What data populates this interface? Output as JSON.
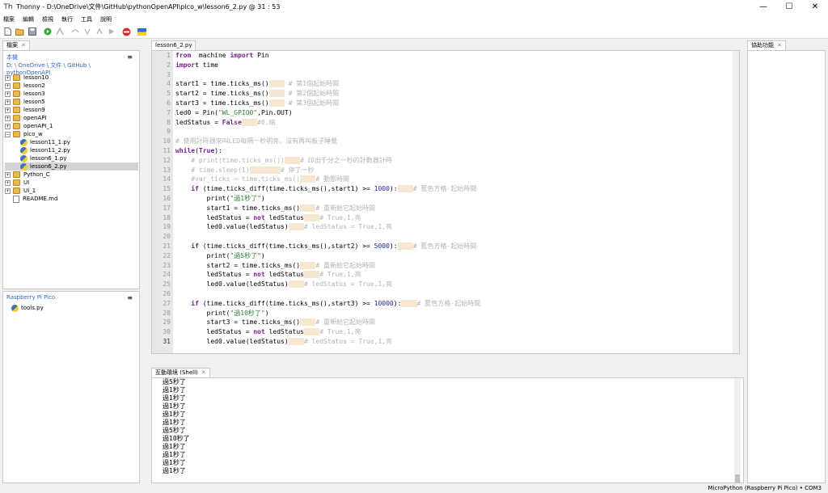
{
  "window": {
    "title": "Thonny  -  D:\\OneDrive\\文件\\GitHub\\pythonOpenAPI\\pico_w\\lesson6_2.py  @  31 : 53",
    "minimize": "—",
    "maximize": "☐",
    "close": "✕"
  },
  "menu": [
    "檔案",
    "編輯",
    "檢視",
    "執行",
    "工具",
    "說明"
  ],
  "files_panel": {
    "tab_label": "檔案",
    "local_label": "本機",
    "breadcrumb": "D: \\ OneDrive \\ 文件 \\ GitHub \\ pythonOpenAPI",
    "tree": [
      {
        "label": "lesson10",
        "type": "folder",
        "exp": "+"
      },
      {
        "label": "lesson2",
        "type": "folder",
        "exp": "+"
      },
      {
        "label": "lesson3",
        "type": "folder",
        "exp": "+"
      },
      {
        "label": "lesson5",
        "type": "folder",
        "exp": "+"
      },
      {
        "label": "lesson9",
        "type": "folder",
        "exp": "+"
      },
      {
        "label": "openAPI",
        "type": "folder",
        "exp": "+"
      },
      {
        "label": "openAPI_1",
        "type": "folder",
        "exp": "+"
      },
      {
        "label": "pico_w",
        "type": "folder",
        "exp": "−"
      },
      {
        "label": "lesson11_1.py",
        "type": "py"
      },
      {
        "label": "lesson11_2.py",
        "type": "py"
      },
      {
        "label": "lesson6_1.py",
        "type": "py"
      },
      {
        "label": "lesson6_2.py",
        "type": "py",
        "selected": true
      },
      {
        "label": "Python_C",
        "type": "folder",
        "exp": "+"
      },
      {
        "label": "UI",
        "type": "folder",
        "exp": "+"
      },
      {
        "label": "UI_1",
        "type": "folder",
        "exp": "+"
      },
      {
        "label": "README.md",
        "type": "doc"
      }
    ],
    "device_label": "Raspberry Pi Pico",
    "device_files": [
      "tools.py"
    ]
  },
  "editor": {
    "tab_label": "lesson6_2.py",
    "current_line": 31
  },
  "shell": {
    "tab_label": "互動環境 (Shell)",
    "lines": [
      "過5秒了",
      "過1秒了",
      "過1秒了",
      "過1秒了",
      "過1秒了",
      "過1秒了",
      "過5秒了",
      "過10秒了",
      "過1秒了",
      "過1秒了",
      "過1秒了",
      "過1秒了"
    ]
  },
  "assistant": {
    "tab_label": "協助功能"
  },
  "status": {
    "text": "MicroPython (Raspberry Pi Pico)  •  COM3"
  },
  "code_lines": [
    [
      [
        "kw",
        "from"
      ],
      [
        "",
        "  machine "
      ],
      [
        "kw",
        "import"
      ],
      [
        "",
        " Pin"
      ]
    ],
    [
      [
        "kw",
        "import"
      ],
      [
        "",
        " time"
      ]
    ],
    [],
    [
      [
        "",
        "start1 = time.ticks_ms()"
      ],
      [
        "sp",
        "    "
      ],
      [
        "cm",
        " # 第1個起始時間"
      ]
    ],
    [
      [
        "",
        "start2 = time.ticks_ms()"
      ],
      [
        "sp",
        "    "
      ],
      [
        "cm",
        " # 第2個起始時間"
      ]
    ],
    [
      [
        "",
        "start3 = time.ticks_ms()"
      ],
      [
        "sp",
        "    "
      ],
      [
        "cm",
        " # 第3個起始時間"
      ]
    ],
    [
      [
        "",
        "led0 = Pin("
      ],
      [
        "st",
        "\"WL_GPIO0\""
      ],
      [
        "",
        ",Pin.OUT)"
      ]
    ],
    [
      [
        "",
        "ledStatus = "
      ],
      [
        "kw",
        "False"
      ],
      [
        "sp",
        "    "
      ],
      [
        "cm",
        "#0,暗"
      ]
    ],
    [],
    [
      [
        "cm",
        "# 使用計時器來叫LED每隔一秒明亮，沒有再叫板子睡覺"
      ]
    ],
    [
      [
        "kw",
        "while"
      ],
      [
        "",
        "("
      ],
      [
        "kw",
        "True"
      ],
      [
        "",
        "):"
      ]
    ],
    [
      [
        "cm",
        "    # print(time.ticks_ms())"
      ],
      [
        "sp",
        "    "
      ],
      [
        "cm",
        "# 印出千分之一秒的計數器計時"
      ]
    ],
    [
      [
        "cm",
        "    # time.sleep(1)"
      ],
      [
        "sp",
        "        "
      ],
      [
        "cm",
        "# 停了一秒"
      ]
    ],
    [
      [
        "cm",
        "    #var_ticks = time.ticks_ms()"
      ],
      [
        "sp",
        "    "
      ],
      [
        "cm",
        "# 動態時間"
      ]
    ],
    [
      [
        "",
        "    "
      ],
      [
        "kw",
        "if"
      ],
      [
        "",
        " (time.ticks_diff(time.ticks_ms(),start1) >= "
      ],
      [
        "nm",
        "1000"
      ],
      [
        "",
        "):"
      ],
      [
        "sp",
        "    "
      ],
      [
        "cm",
        "# 藍色方格-起始時間"
      ]
    ],
    [
      [
        "",
        "        print("
      ],
      [
        "st",
        "\"過1秒了\""
      ],
      [
        "",
        ")"
      ]
    ],
    [
      [
        "",
        "        start1 = time.ticks_ms()"
      ],
      [
        "sp",
        "    "
      ],
      [
        "cm",
        "# 重新給它起始時間"
      ]
    ],
    [
      [
        "",
        "        ledStatus = "
      ],
      [
        "kw",
        "not"
      ],
      [
        "",
        " ledStatus"
      ],
      [
        "sp",
        "    "
      ],
      [
        "cm",
        "# True,1,亮"
      ]
    ],
    [
      [
        "",
        "        led0.value(ledStatus)"
      ],
      [
        "sp",
        "    "
      ],
      [
        "cm",
        "# ledStatus = True,1,亮"
      ]
    ],
    [],
    [
      [
        "",
        "    "
      ],
      [
        "kw",
        "if"
      ],
      [
        "",
        " (time.ticks_diff(time.ticks_ms(),start2) >= "
      ],
      [
        "nm",
        "5000"
      ],
      [
        "",
        "):"
      ],
      [
        "sp",
        "    "
      ],
      [
        "cm",
        "# 藍色方格-起始時間"
      ]
    ],
    [
      [
        "",
        "        print("
      ],
      [
        "st",
        "\"過5秒了\""
      ],
      [
        "",
        ")"
      ]
    ],
    [
      [
        "",
        "        start2 = time.ticks_ms()"
      ],
      [
        "sp",
        "    "
      ],
      [
        "cm",
        "# 重新給它起始時間"
      ]
    ],
    [
      [
        "",
        "        ledStatus = "
      ],
      [
        "kw",
        "not"
      ],
      [
        "",
        " ledStatus"
      ],
      [
        "sp",
        "    "
      ],
      [
        "cm",
        "# True,1,亮"
      ]
    ],
    [
      [
        "",
        "        led0.value(ledStatus)"
      ],
      [
        "sp",
        "    "
      ],
      [
        "cm",
        "# ledStatus = True,1,亮"
      ]
    ],
    [],
    [
      [
        "",
        "    "
      ],
      [
        "kw",
        "if"
      ],
      [
        "",
        " (time.ticks_diff(time.ticks_ms(),start3) >= "
      ],
      [
        "nm",
        "10000"
      ],
      [
        "",
        "):"
      ],
      [
        "sp",
        "    "
      ],
      [
        "cm",
        "# 藍色方格-起始時間"
      ]
    ],
    [
      [
        "",
        "        print("
      ],
      [
        "st",
        "\"過10秒了\""
      ],
      [
        "",
        ")"
      ]
    ],
    [
      [
        "",
        "        start3 = time.ticks_ms()"
      ],
      [
        "sp",
        "    "
      ],
      [
        "cm",
        "# 重新給它起始時間"
      ]
    ],
    [
      [
        "",
        "        ledStatus = "
      ],
      [
        "kw",
        "not"
      ],
      [
        "",
        " ledStatus"
      ],
      [
        "sp",
        "    "
      ],
      [
        "cm",
        "# True,1,亮"
      ]
    ],
    [
      [
        "",
        "        led0.value(ledStatus)"
      ],
      [
        "sp",
        "    "
      ],
      [
        "cm",
        "# ledStatus = True,1,亮"
      ]
    ]
  ],
  "icons": [
    "new-file-icon",
    "open-folder-icon",
    "save-icon",
    "run-icon",
    "debug-icon",
    "step-over-icon",
    "step-into-icon",
    "step-out-icon",
    "resume-icon",
    "stop-icon",
    "ukraine-flag-icon"
  ]
}
